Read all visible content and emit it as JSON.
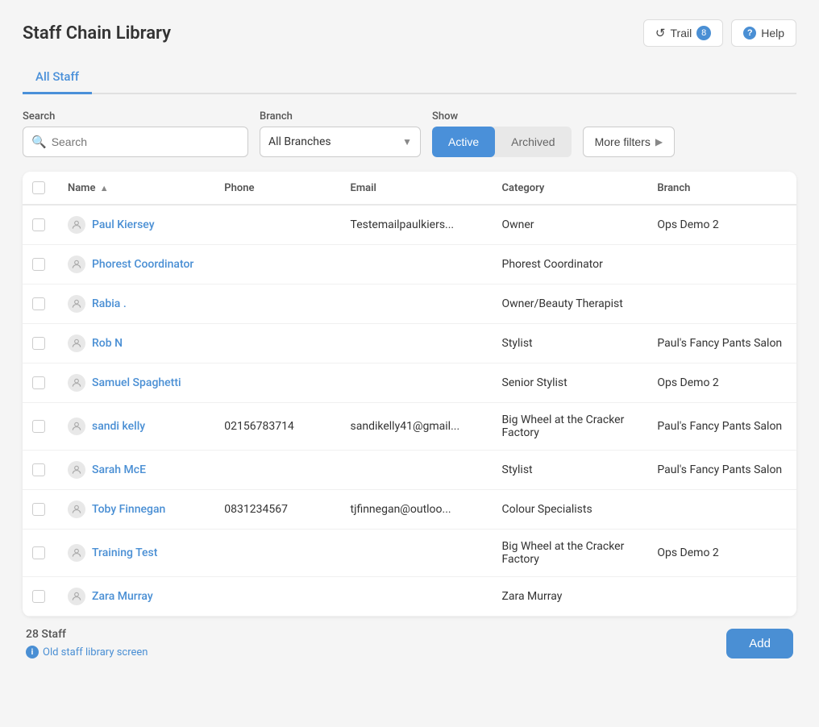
{
  "app": {
    "title": "Staff Chain Library"
  },
  "header_buttons": {
    "trail_label": "Trail",
    "help_label": "Help"
  },
  "tabs": [
    {
      "id": "all_staff",
      "label": "All Staff",
      "active": true
    }
  ],
  "filters": {
    "search_label": "Search",
    "search_placeholder": "Search",
    "branch_label": "Branch",
    "branch_value": "All Branches",
    "show_label": "Show",
    "show_active": "Active",
    "show_archived": "Archived",
    "more_filters_label": "More filters"
  },
  "table": {
    "columns": [
      {
        "id": "name",
        "label": "Name"
      },
      {
        "id": "phone",
        "label": "Phone"
      },
      {
        "id": "email",
        "label": "Email"
      },
      {
        "id": "category",
        "label": "Category"
      },
      {
        "id": "branch",
        "label": "Branch"
      }
    ],
    "rows": [
      {
        "name": "Paul Kiersey",
        "phone": "",
        "email": "Testemailpaulkiers...",
        "category": "Owner",
        "branch": "Ops Demo 2"
      },
      {
        "name": "Phorest Coordinator",
        "phone": "",
        "email": "",
        "category": "Phorest Coordinator",
        "branch": ""
      },
      {
        "name": "Rabia .",
        "phone": "",
        "email": "",
        "category": "Owner/Beauty Therapist",
        "branch": ""
      },
      {
        "name": "Rob N",
        "phone": "",
        "email": "",
        "category": "Stylist",
        "branch": "Paul's Fancy Pants Salon"
      },
      {
        "name": "Samuel Spaghetti",
        "phone": "",
        "email": "",
        "category": "Senior Stylist",
        "branch": "Ops Demo 2"
      },
      {
        "name": "sandi kelly",
        "phone": "02156783714",
        "email": "sandikelly41@gmail...",
        "category": "Big Wheel at the Cracker Factory",
        "branch": "Paul's Fancy Pants Salon"
      },
      {
        "name": "Sarah McE",
        "phone": "",
        "email": "",
        "category": "Stylist",
        "branch": "Paul's Fancy Pants Salon"
      },
      {
        "name": "Toby Finnegan",
        "phone": "0831234567",
        "email": "tjfinnegan@outloo...",
        "category": "Colour Specialists",
        "branch": ""
      },
      {
        "name": "Training Test",
        "phone": "",
        "email": "",
        "category": "Big Wheel at the Cracker Factory",
        "branch": "Ops Demo 2"
      },
      {
        "name": "Zara Murray",
        "phone": "",
        "email": "",
        "category": "Zara Murray",
        "branch": ""
      }
    ]
  },
  "footer": {
    "staff_count": "28 Staff",
    "old_screen_label": "Old staff library screen",
    "add_label": "Add"
  }
}
